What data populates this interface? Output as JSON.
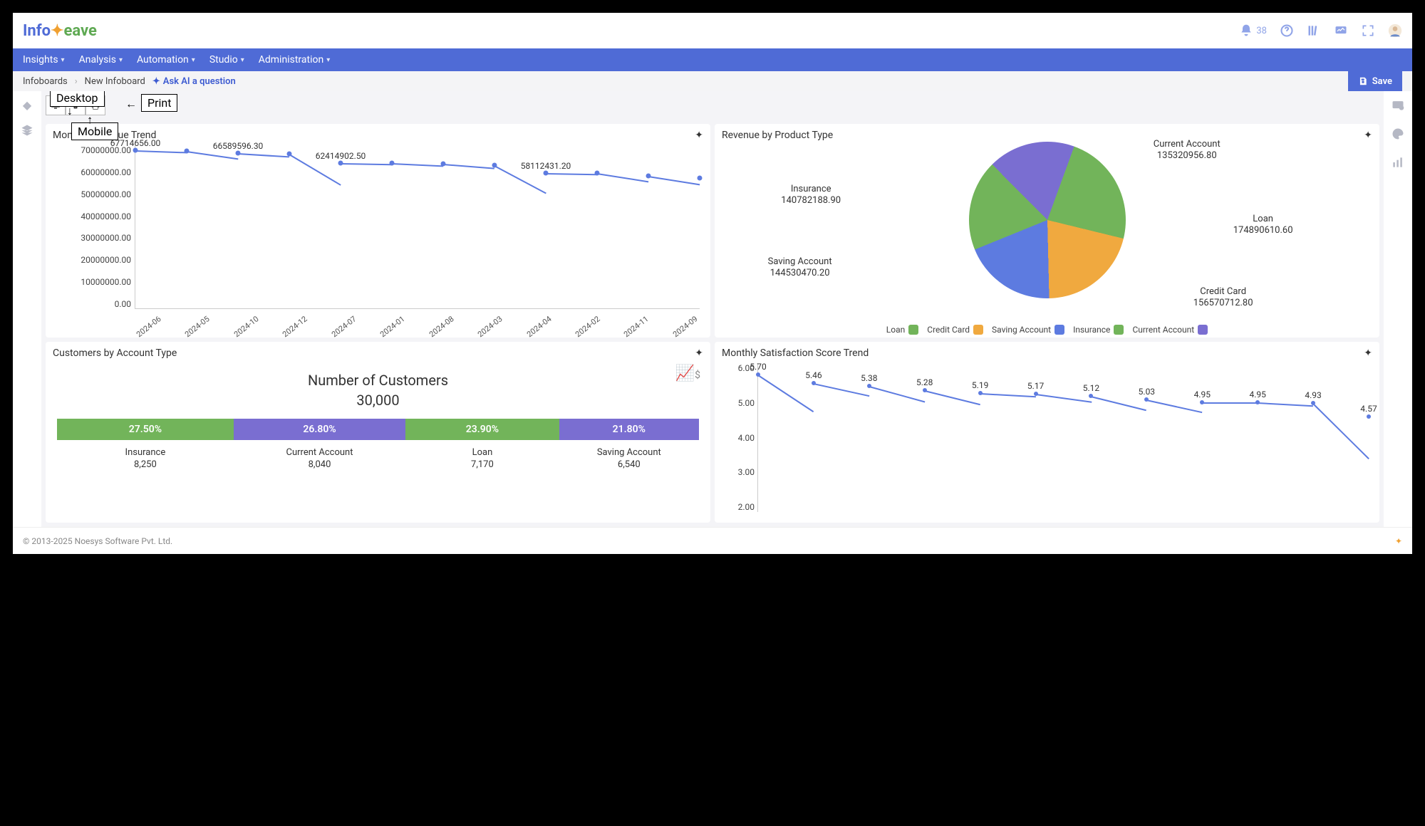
{
  "brand": {
    "part1": "Info",
    "part2": "eave"
  },
  "top_icons": {
    "notif_count": "38"
  },
  "menu": {
    "items": [
      "Insights",
      "Analysis",
      "Automation",
      "Studio",
      "Administration"
    ]
  },
  "breadcrumb": {
    "root": "Infoboards",
    "current": "New Infoboard",
    "ai": "Ask AI a question",
    "ai_prefix": "✦"
  },
  "save": {
    "label": "Save"
  },
  "annotations": {
    "desktop": "Desktop",
    "mobile": "Mobile",
    "print": "Print"
  },
  "footer": {
    "copyright": "© 2013-2025 Noesys Software Pvt. Ltd."
  },
  "cards": {
    "monthly_revenue": {
      "title": "Monthly Revenue Trend"
    },
    "revenue_product": {
      "title": "Revenue by Product Type"
    },
    "customers": {
      "title": "Customers by Account Type",
      "heading": "Number of Customers",
      "total": "30,000"
    },
    "satisfaction": {
      "title": "Monthly Satisfaction Score Trend"
    }
  },
  "colors": {
    "green": "#72b45a",
    "purple": "#7a6ed1",
    "blue": "#5d7be0",
    "orange": "#f0a93f"
  },
  "chart_data": [
    {
      "id": "monthly_revenue",
      "type": "line",
      "x": [
        "2024-06",
        "2024-05",
        "2024-10",
        "2024-12",
        "2024-07",
        "2024-01",
        "2024-08",
        "2024-03",
        "2024-04",
        "2024-02",
        "2024-11",
        "2024-09"
      ],
      "values": [
        67714656.0,
        67500000,
        66589596.3,
        66200000,
        62414902.5,
        62300000,
        62000000,
        61500000,
        58112431.2,
        58000000,
        57000000,
        56000000
      ],
      "ylim": [
        0,
        70000000
      ],
      "yticks": [
        "70000000.00",
        "60000000.00",
        "50000000.00",
        "40000000.00",
        "30000000.00",
        "20000000.00",
        "10000000.00",
        "0.00"
      ],
      "labels": [
        {
          "i": 0,
          "text": "67714656.00"
        },
        {
          "i": 2,
          "text": "66589596.30"
        },
        {
          "i": 4,
          "text": "62414902.50"
        },
        {
          "i": 8,
          "text": "58112431.20"
        }
      ]
    },
    {
      "id": "revenue_product",
      "type": "pie",
      "series": [
        {
          "name": "Loan",
          "value": 174890610.6,
          "color": "#72b45a"
        },
        {
          "name": "Credit Card",
          "value": 156570712.8,
          "color": "#f0a93f"
        },
        {
          "name": "Saving Account",
          "value": 144530470.2,
          "color": "#5d7be0"
        },
        {
          "name": "Insurance",
          "value": 140782188.9,
          "color": "#72b45a"
        },
        {
          "name": "Current Account",
          "value": 135320956.8,
          "color": "#7a6ed1"
        }
      ],
      "legend": [
        "Loan",
        "Credit Card",
        "Saving Account",
        "Insurance",
        "Current Account"
      ]
    },
    {
      "id": "customers",
      "type": "bar",
      "categories": [
        "Insurance",
        "Current Account",
        "Loan",
        "Saving Account"
      ],
      "percents": [
        "27.50%",
        "26.80%",
        "23.90%",
        "21.80%"
      ],
      "values_str": [
        "8,250",
        "8,040",
        "7,170",
        "6,540"
      ],
      "values": [
        8250,
        8040,
        7170,
        6540
      ],
      "colors": [
        "#72b45a",
        "#7a6ed1",
        "#72b45a",
        "#7a6ed1"
      ]
    },
    {
      "id": "satisfaction",
      "type": "line",
      "x_count": 12,
      "values": [
        5.7,
        5.46,
        5.38,
        5.28,
        5.19,
        5.17,
        5.12,
        5.03,
        4.95,
        4.95,
        4.93,
        4.57
      ],
      "ylim": [
        2.0,
        6.0
      ],
      "yticks": [
        "6.00",
        "5.00",
        "4.00",
        "3.00",
        "2.00"
      ]
    }
  ]
}
